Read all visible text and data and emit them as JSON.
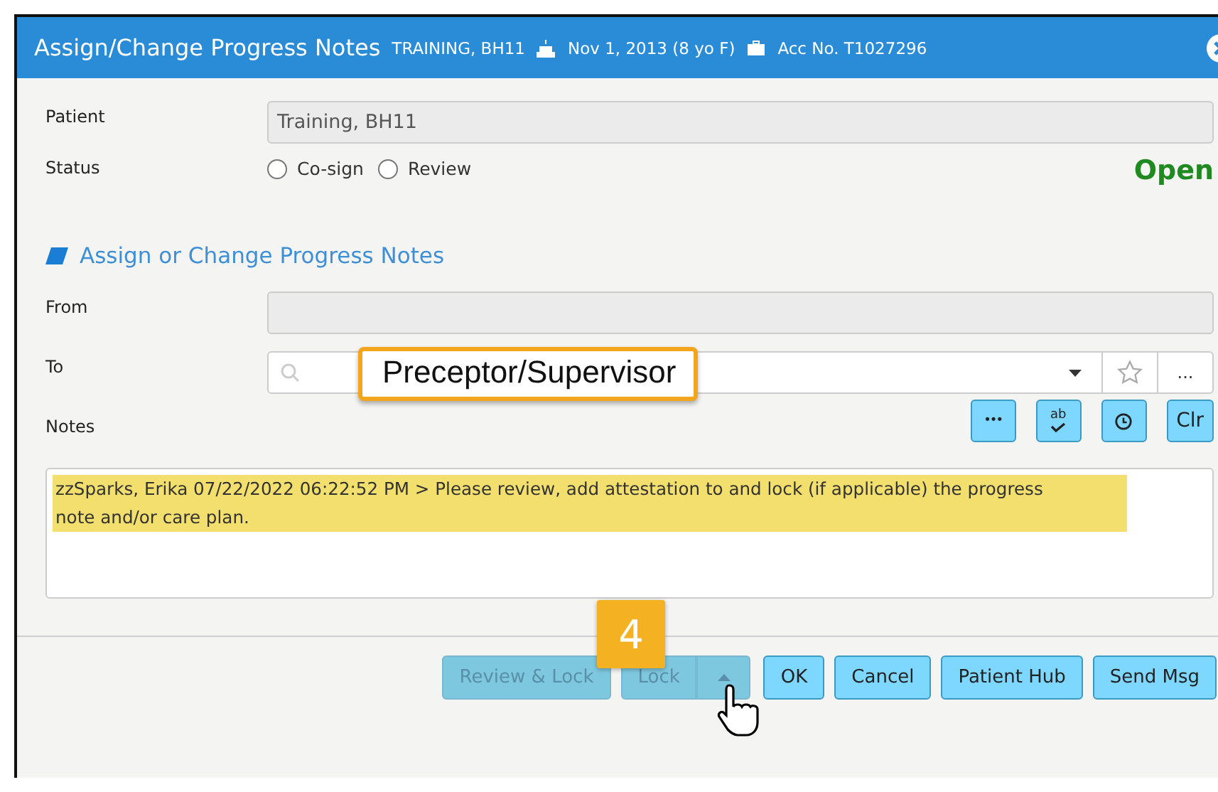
{
  "window": {
    "title": "Assign/Change Progress Notes",
    "patient_name": "TRAINING, BH11",
    "birth": "Nov 1, 2013 (8 yo F)",
    "account": "Acc No. T1027296"
  },
  "patient": {
    "label": "Patient",
    "value": "Training, BH11"
  },
  "status": {
    "label": "Status",
    "options": [
      {
        "label": "Co-sign",
        "selected": false
      },
      {
        "label": "Review",
        "selected": false
      }
    ],
    "state": "Open"
  },
  "section": {
    "title": "Assign or Change Progress Notes"
  },
  "from": {
    "label": "From"
  },
  "to": {
    "label": "To",
    "callout": "Preceptor/Supervisor",
    "more": "..."
  },
  "notes": {
    "label": "Notes",
    "tools": [
      {
        "kind": "dots",
        "label": "•••"
      },
      {
        "kind": "spell",
        "label": "ab"
      },
      {
        "kind": "clock"
      },
      {
        "kind": "text",
        "label": "Clr"
      }
    ],
    "text": "zzSparks, Erika 07/22/2022 06:22:52 PM >  Please review, add attestation to and lock (if applicable) the progress note and/or care plan.",
    "highlighted": true
  },
  "step": "4",
  "buttons": [
    {
      "label": "Review & Lock",
      "disabled": true
    },
    {
      "label": "Lock",
      "disabled": true,
      "split": true
    },
    {
      "label": "OK",
      "disabled": false
    },
    {
      "label": "Cancel",
      "disabled": false
    },
    {
      "label": "Patient Hub",
      "disabled": false
    },
    {
      "label": "Send Msg",
      "disabled": false
    }
  ]
}
